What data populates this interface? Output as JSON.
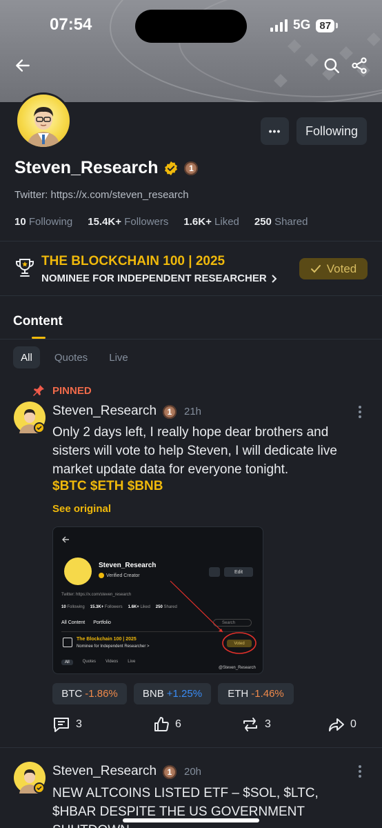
{
  "status_bar": {
    "time": "07:54",
    "network": "5G",
    "battery": "87"
  },
  "profile": {
    "name": "Steven_Research",
    "twitter": "Twitter: https://x.com/steven_research",
    "rank_badge": "1",
    "more_label": "•••",
    "follow_label": "Following",
    "stats": [
      {
        "value": "10",
        "label": "Following"
      },
      {
        "value": "15.4K+",
        "label": "Followers"
      },
      {
        "value": "1.6K+",
        "label": "Liked"
      },
      {
        "value": "250",
        "label": "Shared"
      }
    ]
  },
  "award": {
    "title": "THE BLOCKCHAIN 100 | 2025",
    "subtitle": "NOMINEE FOR INDEPENDENT RESEARCHER",
    "voted_label": "Voted"
  },
  "content_tab": "Content",
  "filters": [
    "All",
    "Quotes",
    "Live"
  ],
  "posts": [
    {
      "pinned_label": "PINNED",
      "author": "Steven_Research",
      "badge": "1",
      "time": "21h",
      "text": "Only 2 days left, I really hope dear brothers and sisters will vote to help Steven, I will dedicate live market update data for everyone tonight.",
      "tickers": "$BTC $ETH $BNB",
      "see_original": "See original",
      "screenshot": {
        "name": "Steven_Research",
        "verified": "Verified Creator",
        "edit": "Edit",
        "twitter": "Twitter: https://x.com/steven_research",
        "stats": [
          {
            "value": "10",
            "label": "Following"
          },
          {
            "value": "15.3K+",
            "label": "Followers"
          },
          {
            "value": "1.6K+",
            "label": "Liked"
          },
          {
            "value": "250",
            "label": "Shared"
          }
        ],
        "tabs": [
          "All Content",
          "Portfolio"
        ],
        "search": "Search",
        "award_title": "The Blockchain 100 | 2025",
        "award_sub": "Nominee for Independent Researcher >",
        "voted": "Voted",
        "filters": [
          "All",
          "Quotes",
          "Videos",
          "Live"
        ],
        "watermark": "@Steven_Research"
      },
      "coins": [
        {
          "symbol": "BTC",
          "change": "-1.86%"
        },
        {
          "symbol": "BNB",
          "change": "+1.25%"
        },
        {
          "symbol": "ETH",
          "change": "-1.46%"
        }
      ],
      "actions": {
        "comments": "3",
        "likes": "6",
        "reposts": "3",
        "shares": "0"
      }
    },
    {
      "author": "Steven_Research",
      "badge": "1",
      "time": "20h",
      "text": "NEW ALTCOINS LISTED ETF – $SOL, $LTC, $HBAR DESPITE THE US GOVERNMENT SHUTDOWN"
    }
  ],
  "colors": {
    "accent": "#f0b90b",
    "background": "#1e2026",
    "negative": "#f6465d",
    "positive": "#3a8cf5"
  }
}
